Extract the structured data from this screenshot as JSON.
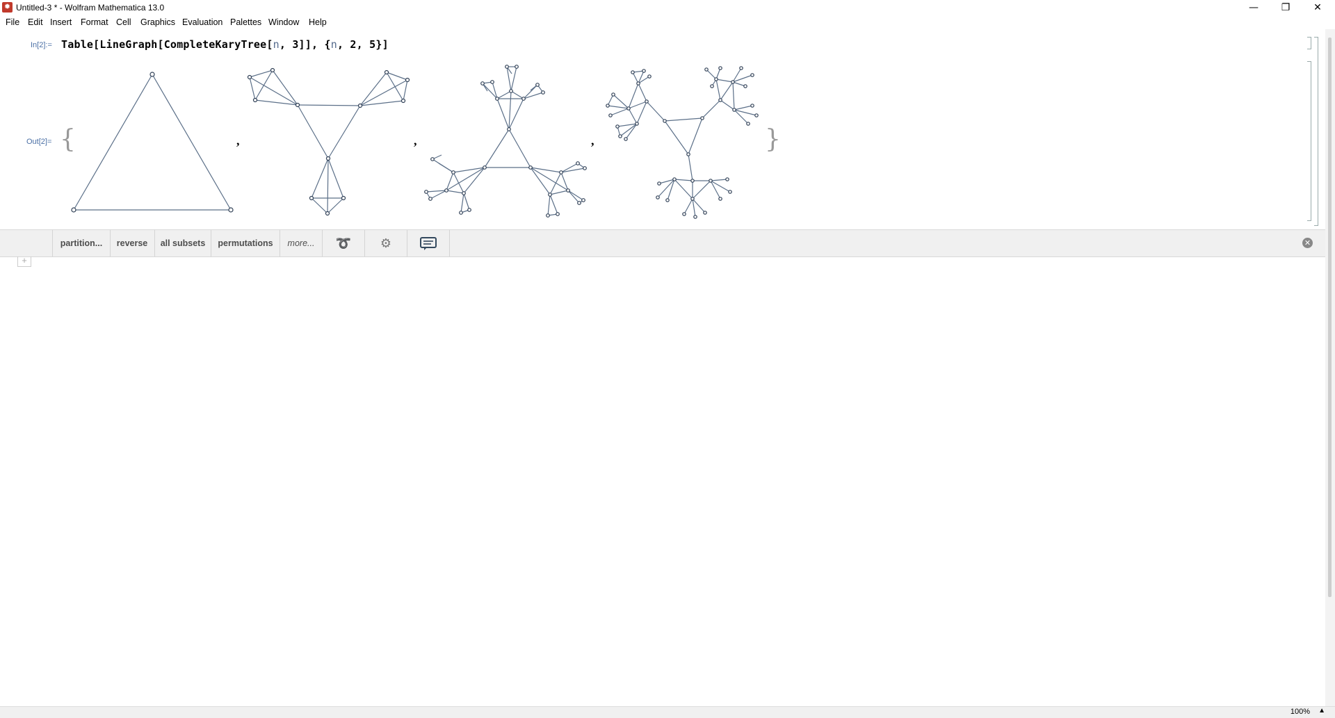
{
  "window": {
    "title": "Untitled-3 * - Wolfram Mathematica 13.0",
    "icon": "mathematica-logo-icon",
    "controls": [
      "minimize-icon",
      "maximize-icon",
      "close-icon"
    ]
  },
  "menu": {
    "items": [
      "File",
      "Edit",
      "Insert",
      "Format",
      "Cell",
      "Graphics",
      "Evaluation",
      "Palettes",
      "Window",
      "Help"
    ]
  },
  "cells": {
    "input_label": "In[2]:=",
    "input_code_parts": [
      "Table[LineGraph[CompleteKaryTree[",
      "n",
      ", 3]], {",
      "n",
      ", 2, 5}]"
    ],
    "output_label": "Out[2]=",
    "open_brace": "{",
    "close_brace": "}",
    "separator": ","
  },
  "suggestions": {
    "buttons": [
      "partition...",
      "reverse",
      "all subsets",
      "permutations",
      "more..."
    ],
    "icons": [
      "iterate-icon",
      "gear-icon",
      "chat-feedback-icon"
    ],
    "close": "close-circle-icon"
  },
  "status": {
    "zoom": "100%",
    "zoom_arrow": "▲"
  },
  "colors": {
    "label_blue": "#4a6fa5",
    "graph_edge": "#5b6f88",
    "suggest_bg": "#f0f0f0"
  }
}
